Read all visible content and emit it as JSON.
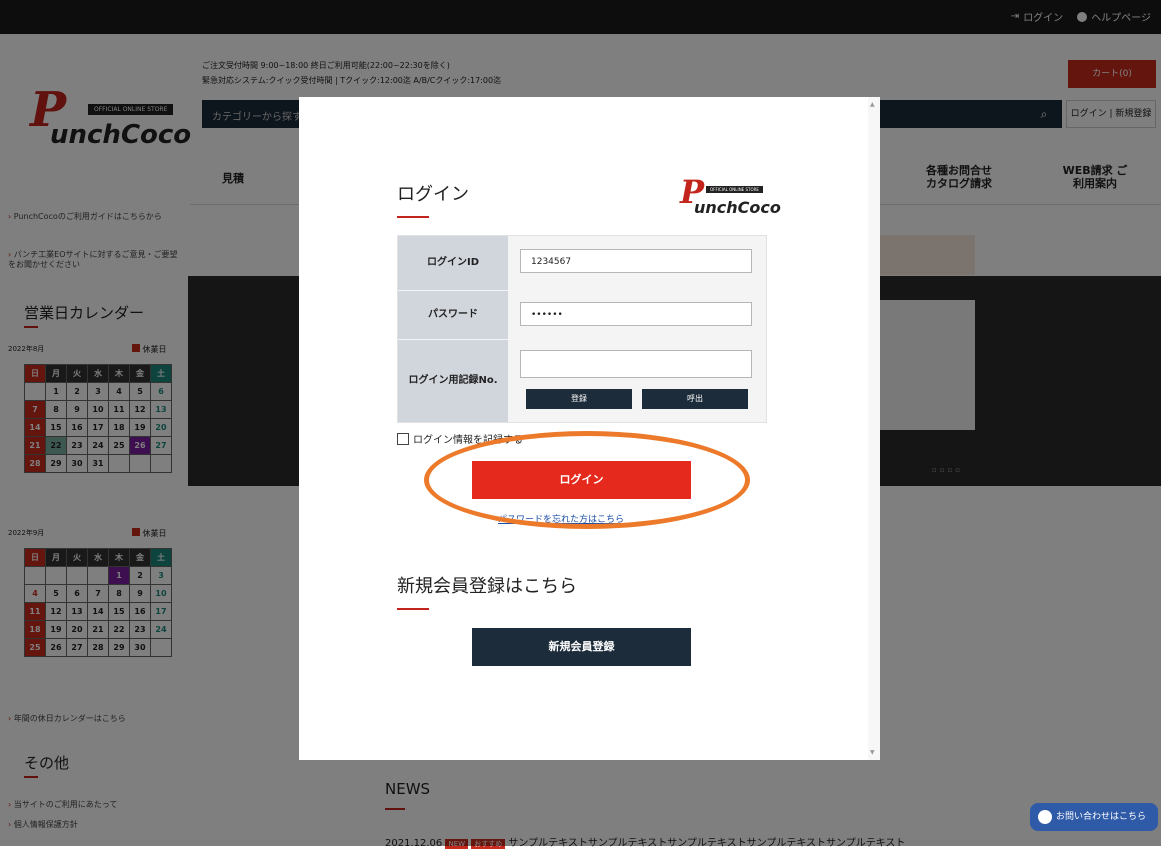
{
  "topbar": {
    "login": "ログイン",
    "help": "ヘルプページ"
  },
  "header": {
    "logo_mark": "P",
    "logo_text": "unchCoco",
    "logo_tag": "OFFICIAL ONLINE STORE",
    "notice_line1": "ご注文受付時間 9:00~18:00 終日ご利用可能(22:00~22:30を除く)",
    "notice_line2": "緊急対応システム:クイック受付時間 | Tクイック:12:00迄 A/B/Cクイック:17:00迄",
    "search_placeholder": "カテゴリーから探す",
    "cart": "カート(0)",
    "login_register": "ログイン | 新規登録"
  },
  "nav": {
    "quote": "見積",
    "contact": "各種お問合せ カタログ請求",
    "web": "WEB請求 ご利用案内"
  },
  "sidebar": {
    "link1": "PunchCocoのご利用ガイドはこちらから",
    "link2": "パンチ工業EOサイトに対するご意見・ご要望をお聞かせください",
    "calendar_title": "営業日カレンダー",
    "holiday_label": "休業日",
    "aug_label": "2022年8月",
    "sep_label": "2022年9月",
    "weekdays": [
      "日",
      "月",
      "火",
      "水",
      "木",
      "金",
      "土"
    ],
    "aug_rows": [
      [
        "",
        "1",
        "2",
        "3",
        "4",
        "5",
        "6"
      ],
      [
        "7",
        "8",
        "9",
        "10",
        "11",
        "12",
        "13"
      ],
      [
        "14",
        "15",
        "16",
        "17",
        "18",
        "19",
        "20"
      ],
      [
        "21",
        "22",
        "23",
        "24",
        "25",
        "26",
        "27"
      ],
      [
        "28",
        "29",
        "30",
        "31",
        "",
        "",
        ""
      ]
    ],
    "sep_rows": [
      [
        "",
        "",
        "",
        "",
        "1",
        "2",
        "3"
      ],
      [
        "4",
        "5",
        "6",
        "7",
        "8",
        "9",
        "10"
      ],
      [
        "11",
        "12",
        "13",
        "14",
        "15",
        "16",
        "17"
      ],
      [
        "18",
        "19",
        "20",
        "21",
        "22",
        "23",
        "24"
      ],
      [
        "25",
        "26",
        "27",
        "28",
        "29",
        "30",
        ""
      ]
    ],
    "yearly_link": "年間の休日カレンダーはこちら",
    "other_title": "その他",
    "other1": "当サイトのご利用にあたって",
    "other2": "個人情報保護方針"
  },
  "news": {
    "title": "NEWS",
    "item_date": "2021.12.06",
    "item_badge1": "NEW",
    "item_badge2": "おすすめ",
    "item_text": "サンプルテキストサンプルテキストサンプルテキストサンプルテキストサンプルテキスト"
  },
  "chat": {
    "label": "お問い合わせはこちら"
  },
  "modal": {
    "title": "ログイン",
    "logo_mark": "P",
    "logo_text": "unchCoco",
    "logo_tag": "OFFICIAL ONLINE STORE",
    "login_id_label": "ログインID",
    "login_id_value": "1234567",
    "password_label": "パスワード",
    "password_value": "••••••",
    "record_label": "ログイン用記録No.",
    "record_value": "",
    "register_btn": "登録",
    "recall_btn": "呼出",
    "remember_label": "ログイン情報を記録する",
    "login_btn": "ログイン",
    "forgot_link": "パスワードを忘れた方はこちら",
    "register_title": "新規会員登録はこちら",
    "register_btn_big": "新規会員登録"
  },
  "colors": {
    "brand_red": "#e5291c",
    "navy": "#1d2c3a",
    "highlight": "#ec7a2a"
  }
}
